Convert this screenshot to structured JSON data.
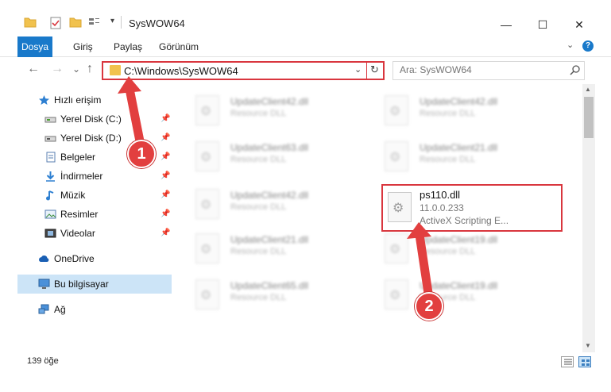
{
  "window": {
    "title": "SysWOW64",
    "minimize": "—",
    "maximize": "☐",
    "close": "✕"
  },
  "ribbon": {
    "tabs": [
      "Dosya",
      "Giriş",
      "Paylaş",
      "Görünüm"
    ],
    "help": "?"
  },
  "nav": {
    "back": "←",
    "forward": "→",
    "recent": "⌄",
    "up": "↑",
    "address": "C:\\Windows\\SysWOW64",
    "refresh": "↻",
    "search_placeholder": "Ara: SysWOW64"
  },
  "sidebar": {
    "items": [
      {
        "label": "Hızlı erişim",
        "icon": "star-icon"
      },
      {
        "label": "Yerel Disk (C:)",
        "icon": "drive-icon",
        "pinned": true
      },
      {
        "label": "Yerel Disk (D:)",
        "icon": "drive-icon",
        "pinned": true
      },
      {
        "label": "Belgeler",
        "icon": "documents-icon",
        "pinned": true
      },
      {
        "label": "İndirmeler",
        "icon": "download-icon",
        "pinned": true
      },
      {
        "label": "Müzik",
        "icon": "music-icon",
        "pinned": true
      },
      {
        "label": "Resimler",
        "icon": "pictures-icon",
        "pinned": true
      },
      {
        "label": "Videolar",
        "icon": "video-icon",
        "pinned": true
      },
      {
        "label": "OneDrive",
        "icon": "cloud-icon"
      },
      {
        "label": "Bu bilgisayar",
        "icon": "computer-icon",
        "selected": true
      },
      {
        "label": "Ağ",
        "icon": "network-icon"
      }
    ]
  },
  "files": [
    {
      "name": "UpdateClient42.dll",
      "desc": "Resource DLL"
    },
    {
      "name": "UpdateClient42.dll",
      "desc": "Resource DLL"
    },
    {
      "name": "UpdateClient63.dll",
      "desc": "Resource DLL"
    },
    {
      "name": "UpdateClient21.dll",
      "desc": "Resource DLL"
    },
    {
      "name": "UpdateClient42.dll",
      "desc": "Resource DLL"
    },
    {
      "name": "UpdateClient21.dll",
      "desc": "Resource DLL"
    },
    {
      "name": "UpdateClient19.dll",
      "desc": "Resource DLL"
    },
    {
      "name": "UpdateClient65.dll",
      "desc": "Resource DLL"
    },
    {
      "name": "UpdateClient19.dll",
      "desc": "Resource DLL"
    }
  ],
  "highlighted_file": {
    "name": "ps110.dll",
    "version": "11.0.0.233",
    "desc": "ActiveX Scripting E..."
  },
  "status": {
    "count": "139 öğe"
  },
  "annotations": {
    "step1": "1",
    "step2": "2",
    "color": "#e23f3f"
  }
}
